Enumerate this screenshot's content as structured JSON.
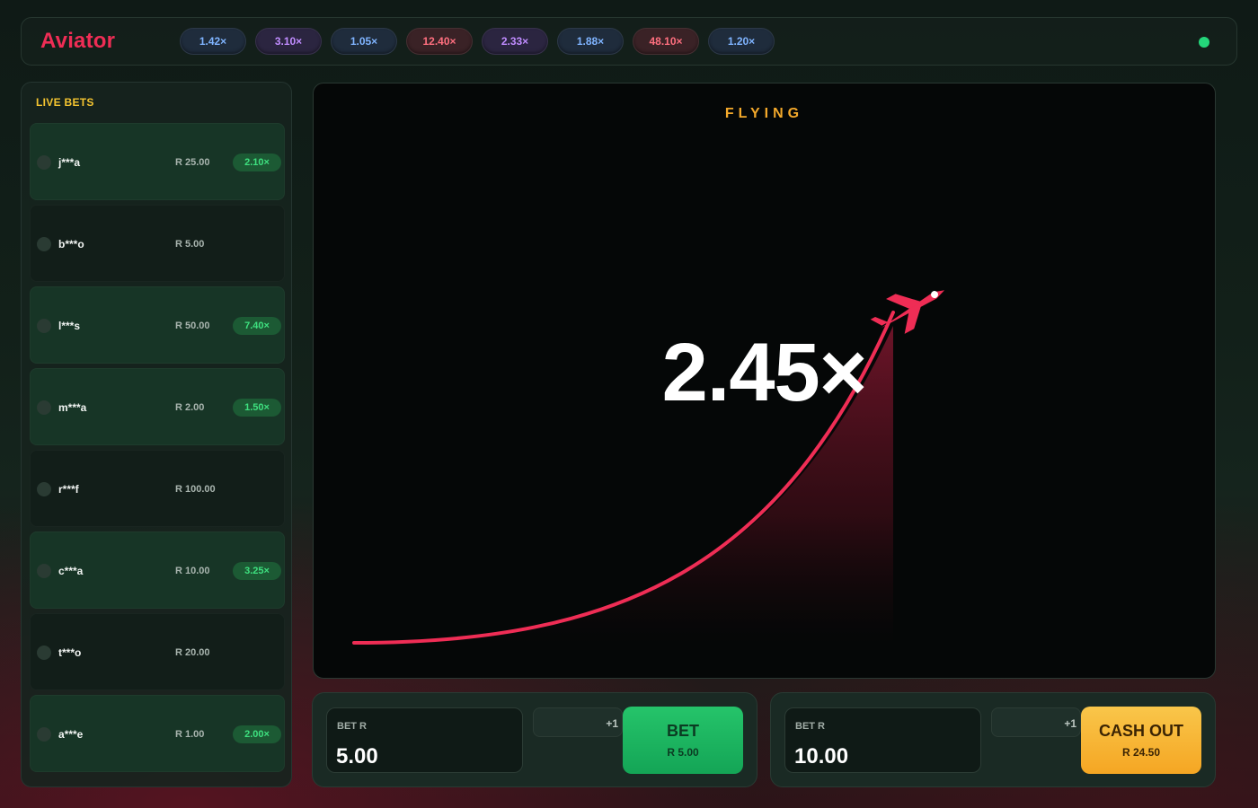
{
  "app": {
    "logo": "Aviator"
  },
  "history": [
    {
      "label": "1.42×",
      "tone": "blue"
    },
    {
      "label": "3.10×",
      "tone": "purple"
    },
    {
      "label": "1.05×",
      "tone": "blue"
    },
    {
      "label": "12.40×",
      "tone": "red"
    },
    {
      "label": "2.33×",
      "tone": "purple"
    },
    {
      "label": "1.88×",
      "tone": "blue"
    },
    {
      "label": "48.10×",
      "tone": "red"
    },
    {
      "label": "1.20×",
      "tone": "blue"
    }
  ],
  "live_bets": {
    "title": "LIVE BETS",
    "rows": [
      {
        "user": "j***a",
        "amount": "R 25.00",
        "multiplier": "2.10×",
        "status": "won"
      },
      {
        "user": "b***o",
        "amount": "R 5.00",
        "multiplier": "",
        "status": "lost"
      },
      {
        "user": "l***s",
        "amount": "R 50.00",
        "multiplier": "7.40×",
        "status": "won"
      },
      {
        "user": "m***a",
        "amount": "R 2.00",
        "multiplier": "1.50×",
        "status": "won"
      },
      {
        "user": "r***f",
        "amount": "R 100.00",
        "multiplier": "",
        "status": "lost"
      },
      {
        "user": "c***a",
        "amount": "R 10.00",
        "multiplier": "3.25×",
        "status": "won"
      },
      {
        "user": "t***o",
        "amount": "R 20.00",
        "multiplier": "",
        "status": "lost"
      },
      {
        "user": "a***e",
        "amount": "R 1.00",
        "multiplier": "2.00×",
        "status": "won"
      }
    ]
  },
  "game": {
    "state": "FLYING",
    "multiplier": "2.45×",
    "curve_color": "#ef2d55",
    "plane_icon": "airplane-icon"
  },
  "bet_panels": [
    {
      "label": "BET R",
      "amount": "5.00",
      "increment": "+1",
      "button": "BET",
      "button_sub": "R 5.00",
      "kind": "bet"
    },
    {
      "label": "BET R",
      "amount": "10.00",
      "increment": "+1",
      "button": "CASH OUT",
      "button_sub": "R 24.50",
      "kind": "cash"
    }
  ],
  "colors": {
    "accent": "#ef2d55",
    "win": "#3ee07f",
    "gold": "#f4a92b",
    "status_online": "#24d67a"
  }
}
